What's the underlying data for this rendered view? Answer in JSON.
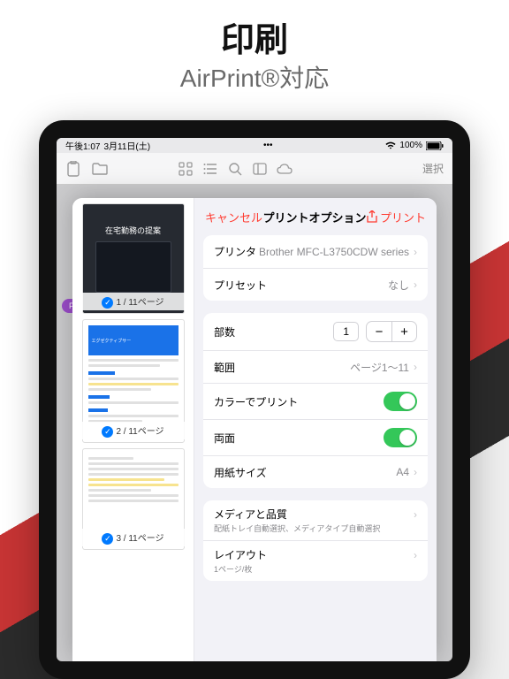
{
  "promo": {
    "title": "印刷",
    "subtitle": "AirPrint®対応"
  },
  "status": {
    "time": "午後1:07",
    "date": "3月11日(土)",
    "battery": "100%"
  },
  "toolbar": {
    "select": "選択"
  },
  "pdf_badge": "PD",
  "thumbs": [
    {
      "caption": "在宅勤務の提案",
      "page": "1 / 11ページ"
    },
    {
      "doc_title": "エグゼクティブサー",
      "page": "2 / 11ページ"
    },
    {
      "page": "3 / 11ページ"
    }
  ],
  "sheet": {
    "cancel": "キャンセル",
    "title": "プリントオプション",
    "print": "プリント"
  },
  "opts": {
    "printer": {
      "label": "プリンタ",
      "value": "Brother MFC-L3750CDW series"
    },
    "preset": {
      "label": "プリセット",
      "value": "なし"
    },
    "copies": {
      "label": "部数",
      "value": "1"
    },
    "range": {
      "label": "範囲",
      "value": "ページ1〜11"
    },
    "color": {
      "label": "カラーでプリント"
    },
    "duplex": {
      "label": "両面"
    },
    "paper": {
      "label": "用紙サイズ",
      "value": "A4"
    },
    "media": {
      "label": "メディアと品質",
      "sub": "配紙トレイ自動選択、メディアタイプ自動選択"
    },
    "layout": {
      "label": "レイアウト",
      "sub": "1ページ/枚"
    }
  }
}
